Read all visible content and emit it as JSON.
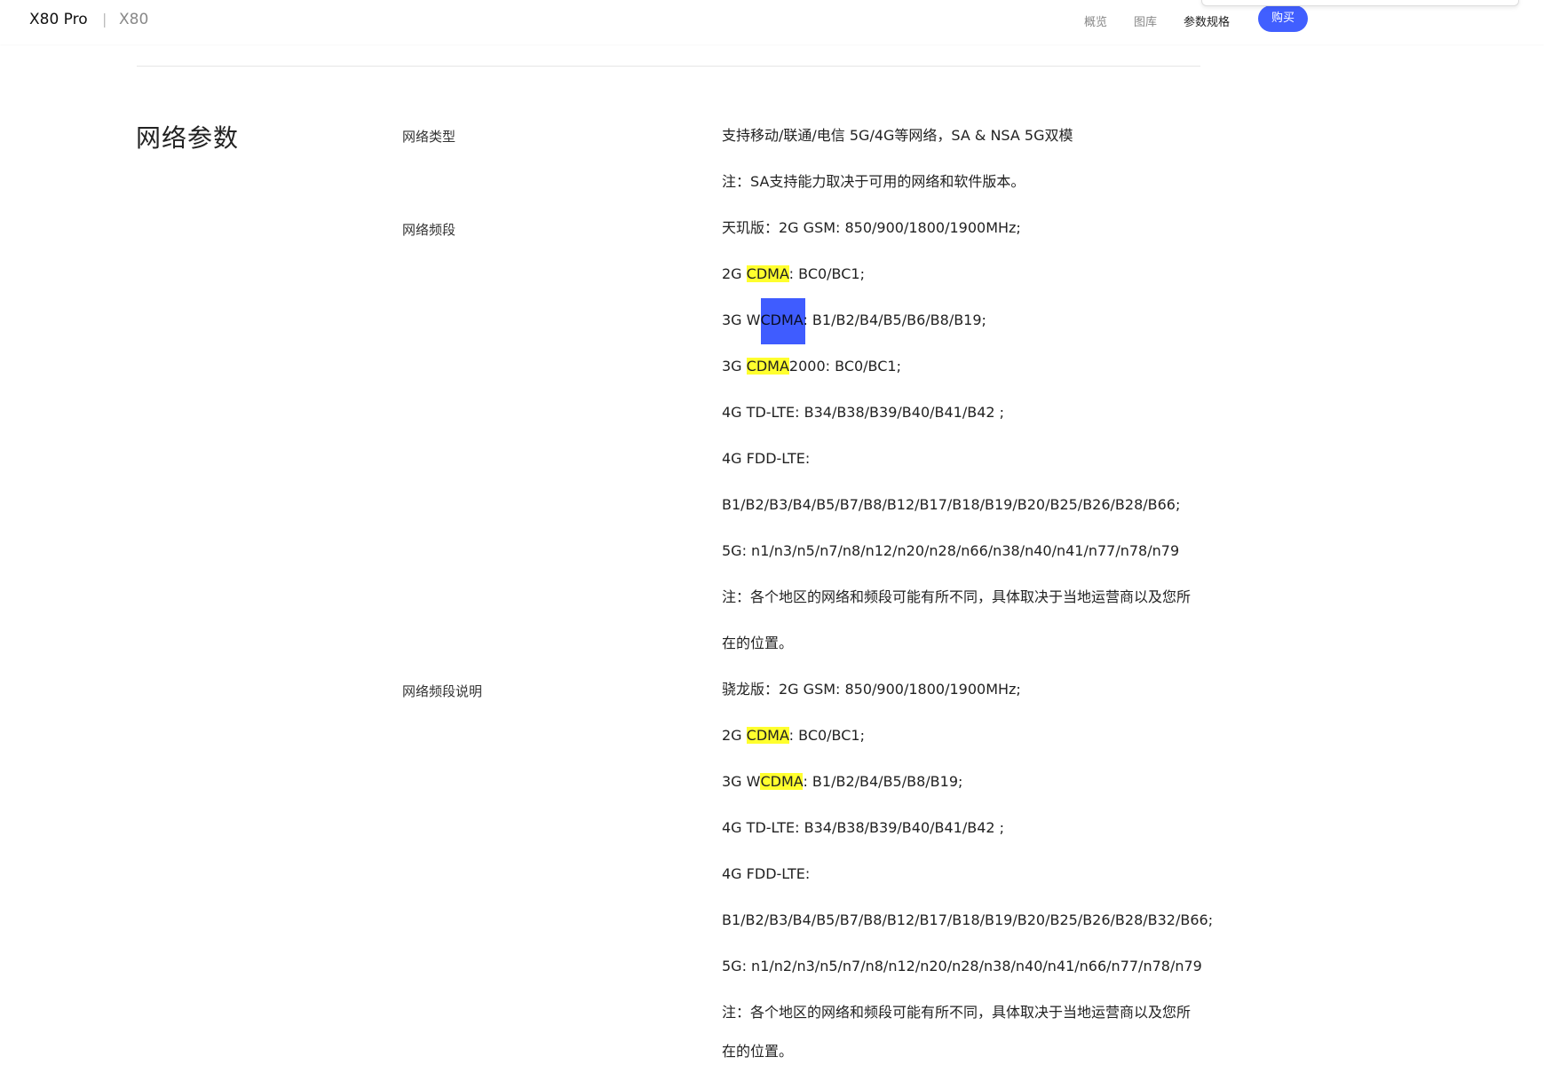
{
  "header": {
    "brand_primary": "X80 Pro",
    "separator": "|",
    "brand_secondary": "X80",
    "nav": [
      "概览",
      "图库",
      "参数规格"
    ],
    "buy_label": "购买"
  },
  "section": {
    "title": "网络参数",
    "labels": {
      "network_type": "网络类型",
      "network_bands": "网络频段",
      "network_bands_note": "网络频段说明"
    }
  },
  "lines": {
    "t1": "支持移动/联通/电信 5G/4G等网络，SA & NSA 5G双模",
    "t2": "注：SA支持能力取决于可用的网络和软件版本。",
    "b1": "天玑版：2G GSM: 850/900/1800/1900MHz;",
    "b2_pre": "2G ",
    "b2_hl": "CDMA",
    "b2_post": ": BC0/BC1;",
    "b3": "3G WCDMA: B1/B2/B4/B5/B6/B8/B19;",
    "b4_pre": "3G ",
    "b4_hl": "CDMA",
    "b4_post": "2000: BC0/BC1;",
    "b5": "4G TD-LTE: B34/B38/B39/B40/B41/B42 ;",
    "b6": "4G FDD-LTE:",
    "b7": "B1/B2/B3/B4/B5/B7/B8/B12/B17/B18/B19/B20/B25/B26/B28/B66;",
    "b8": "5G: n1/n3/n5/n7/n8/n12/n20/n28/n66/n38/n40/n41/n77/n78/n79",
    "b9": "注：各个地区的网络和频段可能有所不同，具体取决于当地运营商以及您所",
    "b10": "在的位置。",
    "s1": "骁龙版：2G GSM: 850/900/1800/1900MHz;",
    "s2_pre": "2G ",
    "s2_hl": "CDMA",
    "s2_post": ": BC0/BC1;",
    "s3_pre": "3G W",
    "s3_hl": "CDMA",
    "s3_post": ": B1/B2/B4/B5/B8/B19;",
    "s4": "4G TD-LTE: B34/B38/B39/B40/B41/B42 ;",
    "s5": "4G FDD-LTE:",
    "s6": "B1/B2/B3/B4/B5/B7/B8/B12/B17/B18/B19/B20/B25/B26/B28/B32/B66;",
    "s7": "5G: n1/n2/n3/n5/n7/n8/n12/n20/n28/n38/n40/n41/n66/n77/n78/n79",
    "s8": "注：各个地区的网络和频段可能有所不同，具体取决于当地运营商以及您所",
    "s9": "在的位置。"
  },
  "colors": {
    "accent": "#415fff",
    "highlight": "#ffff2e",
    "selection": "#3f5cff"
  }
}
